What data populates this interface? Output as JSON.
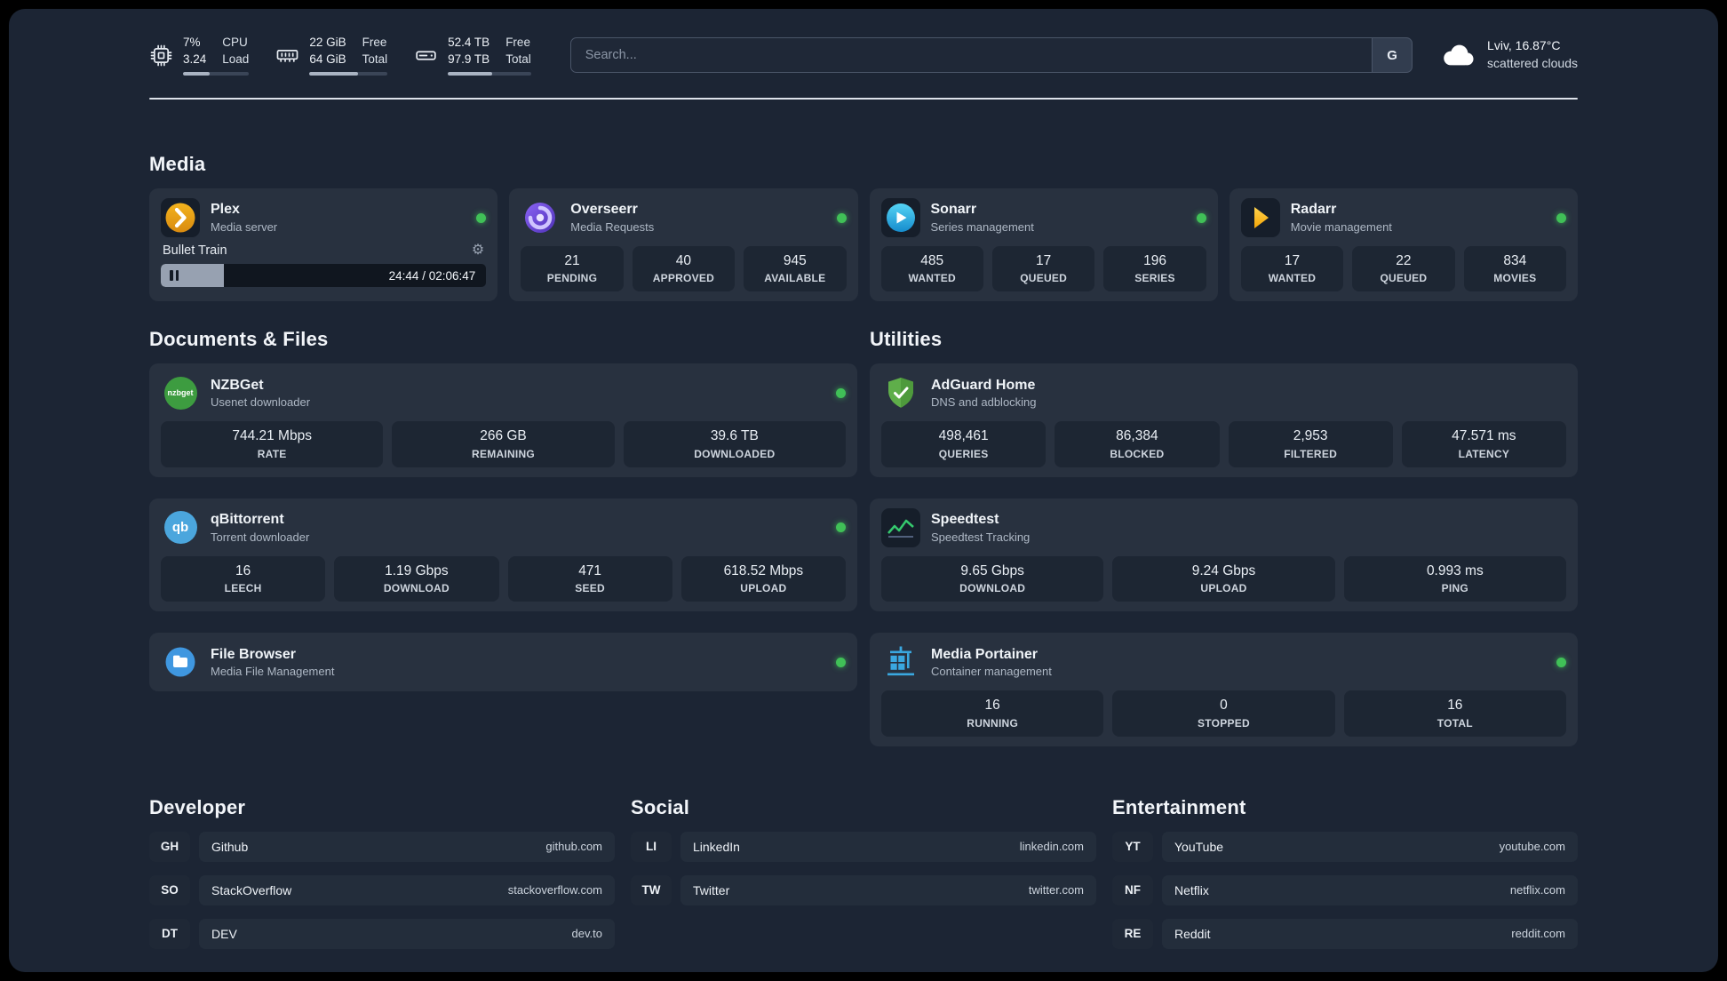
{
  "colors": {
    "status_online": "#40c057",
    "plex": "#e9a11d",
    "overseerr": "#6741d9",
    "sonarr": "#33bfe7",
    "radarr": "#f5a506",
    "nzbget": "#3d9c40",
    "qbittorrent": "#4ba6dd",
    "filebrowser": "#3f97e0",
    "adguard": "#5fae4a",
    "speedtest": "#35c96e",
    "portainer": "#3aa8e0"
  },
  "topbar": {
    "cpu": {
      "icon": "cpu-chip-icon",
      "value1": "7%",
      "value2": "3.24",
      "label1": "CPU",
      "label2": "Load",
      "bar_pct": 40
    },
    "ram": {
      "icon": "ram-icon",
      "value1": "22 GiB",
      "value2": "64 GiB",
      "label1": "Free",
      "label2": "Total",
      "bar_pct": 62
    },
    "disk": {
      "icon": "hard-drive-icon",
      "value1": "52.4 TB",
      "value2": "97.9 TB",
      "label1": "Free",
      "label2": "Total",
      "bar_pct": 53
    },
    "search": {
      "placeholder": "Search...",
      "button_label": "G"
    },
    "weather": {
      "icon": "cloud-icon",
      "location": "Lviv, 16.87°C",
      "condition": "scattered clouds"
    }
  },
  "sections": {
    "media": {
      "title": "Media"
    },
    "documents": {
      "title": "Documents & Files"
    },
    "utilities": {
      "title": "Utilities"
    },
    "developer": {
      "title": "Developer"
    },
    "social": {
      "title": "Social"
    },
    "entertainment": {
      "title": "Entertainment"
    }
  },
  "apps": {
    "plex": {
      "name": "Plex",
      "desc": "Media server",
      "online": true,
      "player": {
        "title": "Bullet Train",
        "time": "24:44 / 02:06:47",
        "progress_pct": 19.5
      }
    },
    "overseerr": {
      "name": "Overseerr",
      "desc": "Media Requests",
      "online": true,
      "stats": [
        {
          "value": "21",
          "label": "PENDING"
        },
        {
          "value": "40",
          "label": "APPROVED"
        },
        {
          "value": "945",
          "label": "AVAILABLE"
        }
      ]
    },
    "sonarr": {
      "name": "Sonarr",
      "desc": "Series management",
      "online": true,
      "stats": [
        {
          "value": "485",
          "label": "WANTED"
        },
        {
          "value": "17",
          "label": "QUEUED"
        },
        {
          "value": "196",
          "label": "SERIES"
        }
      ]
    },
    "radarr": {
      "name": "Radarr",
      "desc": "Movie management",
      "online": true,
      "stats": [
        {
          "value": "17",
          "label": "WANTED"
        },
        {
          "value": "22",
          "label": "QUEUED"
        },
        {
          "value": "834",
          "label": "MOVIES"
        }
      ]
    },
    "nzbget": {
      "name": "NZBGet",
      "desc": "Usenet downloader",
      "online": true,
      "icon_text": "nzbget",
      "stats": [
        {
          "value": "744.21 Mbps",
          "label": "RATE"
        },
        {
          "value": "266 GB",
          "label": "REMAINING"
        },
        {
          "value": "39.6 TB",
          "label": "DOWNLOADED"
        }
      ]
    },
    "qbittorrent": {
      "name": "qBittorrent",
      "desc": "Torrent downloader",
      "online": true,
      "icon_text": "qb",
      "stats": [
        {
          "value": "16",
          "label": "LEECH"
        },
        {
          "value": "1.19 Gbps",
          "label": "DOWNLOAD"
        },
        {
          "value": "471",
          "label": "SEED"
        },
        {
          "value": "618.52 Mbps",
          "label": "UPLOAD"
        }
      ]
    },
    "filebrowser": {
      "name": "File Browser",
      "desc": "Media File Management",
      "online": true
    },
    "adguard": {
      "name": "AdGuard Home",
      "desc": "DNS and adblocking",
      "stats": [
        {
          "value": "498,461",
          "label": "QUERIES"
        },
        {
          "value": "86,384",
          "label": "BLOCKED"
        },
        {
          "value": "2,953",
          "label": "FILTERED"
        },
        {
          "value": "47.571 ms",
          "label": "LATENCY"
        }
      ]
    },
    "speedtest": {
      "name": "Speedtest",
      "desc": "Speedtest Tracking",
      "stats": [
        {
          "value": "9.65 Gbps",
          "label": "DOWNLOAD"
        },
        {
          "value": "9.24 Gbps",
          "label": "UPLOAD"
        },
        {
          "value": "0.993 ms",
          "label": "PING"
        }
      ]
    },
    "portainer": {
      "name": "Media Portainer",
      "desc": "Container management",
      "online": true,
      "stats": [
        {
          "value": "16",
          "label": "RUNNING"
        },
        {
          "value": "0",
          "label": "STOPPED"
        },
        {
          "value": "16",
          "label": "TOTAL"
        }
      ]
    }
  },
  "bookmarks": {
    "developer": [
      {
        "abbr": "GH",
        "name": "Github",
        "url": "github.com"
      },
      {
        "abbr": "SO",
        "name": "StackOverflow",
        "url": "stackoverflow.com"
      },
      {
        "abbr": "DT",
        "name": "DEV",
        "url": "dev.to"
      }
    ],
    "social": [
      {
        "abbr": "LI",
        "name": "LinkedIn",
        "url": "linkedin.com"
      },
      {
        "abbr": "TW",
        "name": "Twitter",
        "url": "twitter.com"
      }
    ],
    "entertainment": [
      {
        "abbr": "YT",
        "name": "YouTube",
        "url": "youtube.com"
      },
      {
        "abbr": "NF",
        "name": "Netflix",
        "url": "netflix.com"
      },
      {
        "abbr": "RE",
        "name": "Reddit",
        "url": "reddit.com"
      }
    ]
  }
}
